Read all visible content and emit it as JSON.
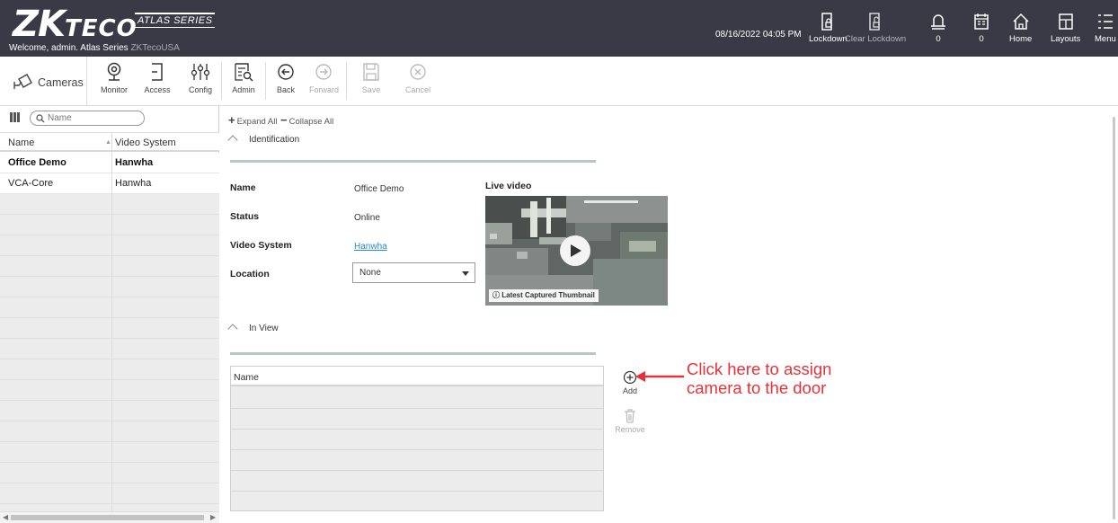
{
  "header": {
    "logo_main": "ZK",
    "logo_sub": "TECO",
    "series": "ATLAS SERIES",
    "welcome": "Welcome, admin.  Atlas Series",
    "brand": "ZKTecoUSA",
    "datetime": "08/16/2022 04:05 PM",
    "buttons": [
      {
        "label": "Lockdown",
        "icon": "lockdown-icon"
      },
      {
        "label": "Clear Lockdown",
        "icon": "clear-lockdown-icon"
      },
      {
        "label": "0",
        "icon": "bell-icon"
      },
      {
        "label": "0",
        "icon": "calendar-icon"
      },
      {
        "label": "Home",
        "icon": "home-icon"
      },
      {
        "label": "Layouts",
        "icon": "layouts-icon"
      },
      {
        "label": "Menu",
        "icon": "menu-icon"
      }
    ]
  },
  "toolbar": {
    "module": "Cameras",
    "tools": [
      {
        "label": "Monitor",
        "icon": "monitor-icon"
      },
      {
        "label": "Access",
        "icon": "access-icon"
      },
      {
        "label": "Config",
        "icon": "config-icon"
      },
      {
        "label": "Admin",
        "icon": "admin-icon"
      },
      {
        "label": "Back",
        "icon": "back-icon"
      },
      {
        "label": "Forward",
        "icon": "forward-icon"
      },
      {
        "label": "Save",
        "icon": "save-icon"
      },
      {
        "label": "Cancel",
        "icon": "cancel-icon"
      }
    ]
  },
  "left": {
    "search_placeholder": "Name",
    "columns": [
      "Name",
      "Video System"
    ],
    "rows": [
      {
        "name": "Office Demo",
        "system": "Hanwha",
        "selected": true
      },
      {
        "name": "VCA-Core",
        "system": "Hanwha",
        "selected": false
      }
    ]
  },
  "main": {
    "expand_all": "Expand All",
    "collapse_all": "Collapse All",
    "identification": {
      "title": "Identification",
      "name_label": "Name",
      "name_value": "Office Demo",
      "status_label": "Status",
      "status_value": "Online",
      "video_system_label": "Video System",
      "video_system_value": "Hanwha",
      "location_label": "Location",
      "location_value": "None",
      "live_video_label": "Live video",
      "thumbnail_label": "Latest Captured Thumbnail"
    },
    "in_view": {
      "title": "In View",
      "column": "Name",
      "add_label": "Add",
      "remove_label": "Remove"
    },
    "annotation_line1": "Click here to assign",
    "annotation_line2": "camera to the door"
  },
  "colors": {
    "header_bg": "#3a3a46",
    "link": "#2a8bc9",
    "annotation": "#e53238",
    "section_line": "#b8c6cc"
  }
}
